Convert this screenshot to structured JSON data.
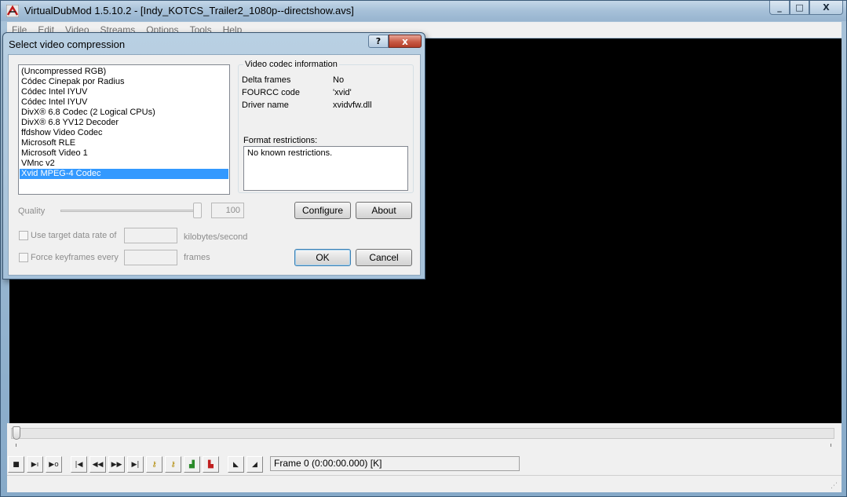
{
  "window": {
    "title": "VirtualDubMod 1.5.10.2 - [Indy_KOTCS_Trailer2_1080p--directshow.avs]",
    "app_icon": "virtualdub-app-icon",
    "controls": {
      "minimize": "_",
      "maximize": "□",
      "close": "X"
    }
  },
  "menu": [
    "File",
    "Edit",
    "Video",
    "Streams",
    "Options",
    "Tools",
    "Help"
  ],
  "dialog": {
    "title": "Select video compression",
    "help_label": "?",
    "close_label": "x",
    "codecs": [
      "(Uncompressed RGB)",
      "Códec Cinepak por Radius",
      "Códec Intel IYUV",
      "Códec Intel IYUV",
      "DivX® 6.8 Codec (2 Logical CPUs)",
      "DivX® 6.8 YV12 Decoder",
      "ffdshow Video Codec",
      "Microsoft RLE",
      "Microsoft Video 1",
      "VMnc v2",
      "Xvid MPEG-4 Codec"
    ],
    "selected_index": 10,
    "info": {
      "legend": "Video codec information",
      "delta_label": "Delta frames",
      "delta_value": "No",
      "fourcc_label": "FOURCC code",
      "fourcc_value": "'xvid'",
      "driver_label": "Driver name",
      "driver_value": "xvidvfw.dll",
      "restrictions_label": "Format restrictions:",
      "restrictions_value": "No known restrictions."
    },
    "quality": {
      "label": "Quality",
      "value": "100",
      "level": 1.0
    },
    "configure_label": "Configure",
    "about_label": "About",
    "target_rate_label": "Use target data rate of",
    "target_rate_unit": "kilobytes/second",
    "keyframes_label": "Force keyframes every",
    "keyframes_unit": "frames",
    "ok_label": "OK",
    "cancel_label": "Cancel"
  },
  "frame_status": "Frame 0 (0:00:00.000) [K]",
  "colors": {
    "selection": "#3399ff",
    "video_bg": "#000000",
    "close_red": "#c85a45"
  }
}
